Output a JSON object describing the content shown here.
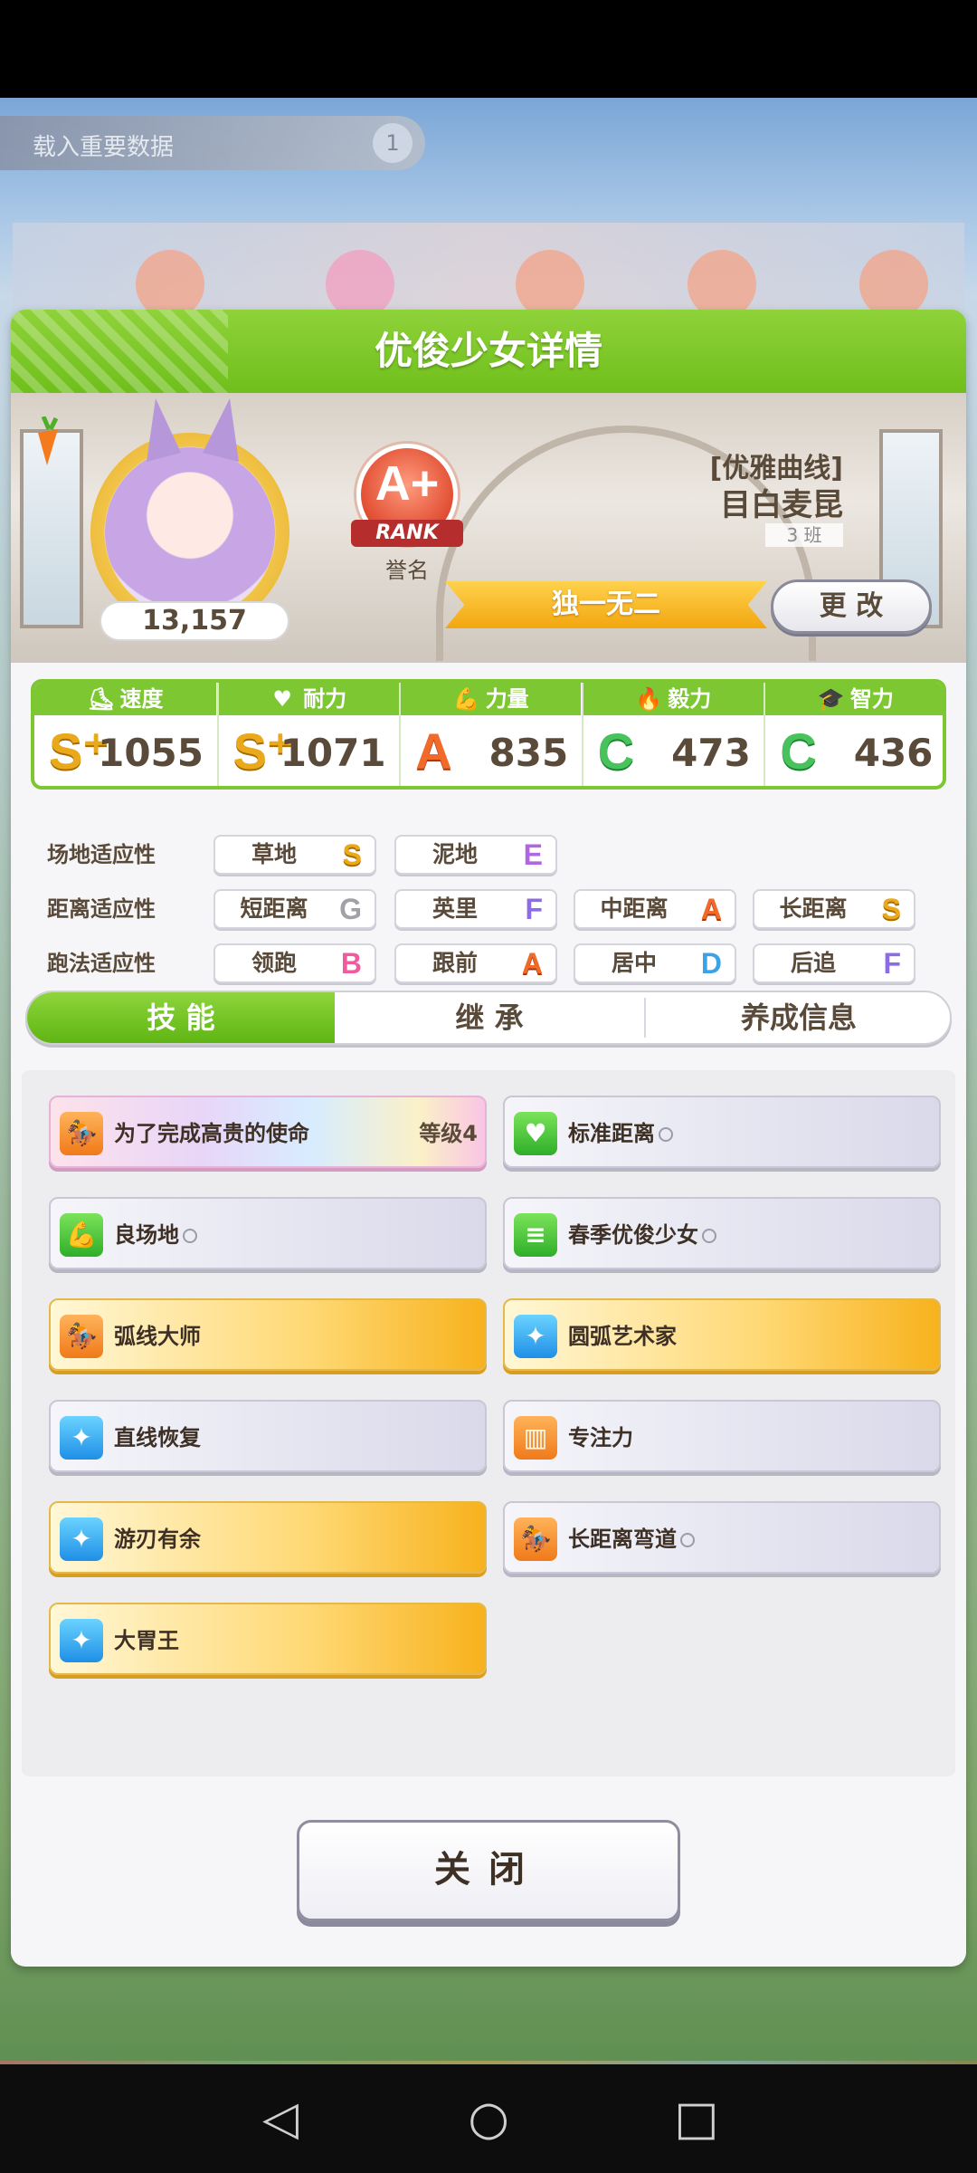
{
  "colors": {
    "accent_green": "#7dc832",
    "gold": "#f7b21d",
    "text_brown": "#5a4a3a"
  },
  "background": {
    "banner_text": "载入重要数据",
    "banner_badge": "1"
  },
  "modal": {
    "title": "优俊少女详情",
    "score": "13,157",
    "rank": {
      "letter": "A+",
      "ribbon": "RANK",
      "caption": "誉名"
    },
    "epithet": "[优雅曲线]",
    "name": "目白麦昆",
    "class_label": "3 班",
    "title_banner": "独一无二",
    "change_button": "更 改"
  },
  "stats": [
    {
      "label": "速度",
      "icon": "speed-icon",
      "glyph": "⛸",
      "grade": "S⁺",
      "grade_class": "grade-S",
      "value": "1055"
    },
    {
      "label": "耐力",
      "icon": "heart-icon",
      "glyph": "♥",
      "grade": "S⁺",
      "grade_class": "grade-S",
      "value": "1071"
    },
    {
      "label": "力量",
      "icon": "muscle-icon",
      "glyph": "💪",
      "grade": "A",
      "grade_class": "grade-A",
      "value": "835"
    },
    {
      "label": "毅力",
      "icon": "flame-icon",
      "glyph": "🔥",
      "grade": "C",
      "grade_class": "grade-C",
      "value": "473"
    },
    {
      "label": "智力",
      "icon": "graduation-cap-icon",
      "glyph": "🎓",
      "grade": "C",
      "grade_class": "grade-C",
      "value": "436"
    }
  ],
  "aptitude": {
    "track_label": "场地适应性",
    "distance_label": "距离适应性",
    "style_label": "跑法适应性",
    "track": [
      {
        "name": "草地",
        "grade": "S"
      },
      {
        "name": "泥地",
        "grade": "E"
      }
    ],
    "distance": [
      {
        "name": "短距离",
        "grade": "G"
      },
      {
        "name": "英里",
        "grade": "F"
      },
      {
        "name": "中距离",
        "grade": "A"
      },
      {
        "name": "长距离",
        "grade": "S"
      }
    ],
    "style": [
      {
        "name": "领跑",
        "grade": "B"
      },
      {
        "name": "跟前",
        "grade": "A"
      },
      {
        "name": "居中",
        "grade": "D"
      },
      {
        "name": "后追",
        "grade": "F"
      }
    ]
  },
  "tabs": [
    {
      "label": "技 能"
    },
    {
      "label": "继 承"
    },
    {
      "label": "养成信息"
    }
  ],
  "skills": [
    {
      "name": "为了完成高贵的使命",
      "level": "等级4",
      "style": "rainbow",
      "icon": "runner-icon",
      "icon_color": "ic-orange"
    },
    {
      "name": "标准距离",
      "style": "plain",
      "ring": true,
      "icon": "heart-icon",
      "icon_color": "ic-green"
    },
    {
      "name": "良场地",
      "style": "plain",
      "ring": true,
      "icon": "muscle-icon",
      "icon_color": "ic-green"
    },
    {
      "name": "春季优俊少女",
      "style": "plain",
      "ring": true,
      "icon": "speed-lines-icon",
      "icon_color": "ic-green"
    },
    {
      "name": "弧线大师",
      "style": "gold",
      "icon": "runner-icon",
      "icon_color": "ic-orange"
    },
    {
      "name": "圆弧艺术家",
      "style": "gold",
      "icon": "sparkle-icon",
      "icon_color": "ic-blue"
    },
    {
      "name": "直线恢复",
      "style": "plain",
      "icon": "sparkle-icon",
      "icon_color": "ic-blue"
    },
    {
      "name": "专注力",
      "style": "plain",
      "icon": "gate-icon",
      "icon_color": "ic-orange"
    },
    {
      "name": "游刃有余",
      "style": "gold",
      "icon": "sparkle-icon",
      "icon_color": "ic-blue"
    },
    {
      "name": "长距离弯道",
      "style": "plain",
      "ring": true,
      "icon": "runner-icon",
      "icon_color": "ic-orange"
    },
    {
      "name": "大胃王",
      "style": "gold",
      "icon": "sparkle-icon",
      "icon_color": "ic-blue"
    }
  ],
  "close_button": "关闭",
  "navbar": {
    "back": "◁",
    "home": "○",
    "recents": "□"
  }
}
